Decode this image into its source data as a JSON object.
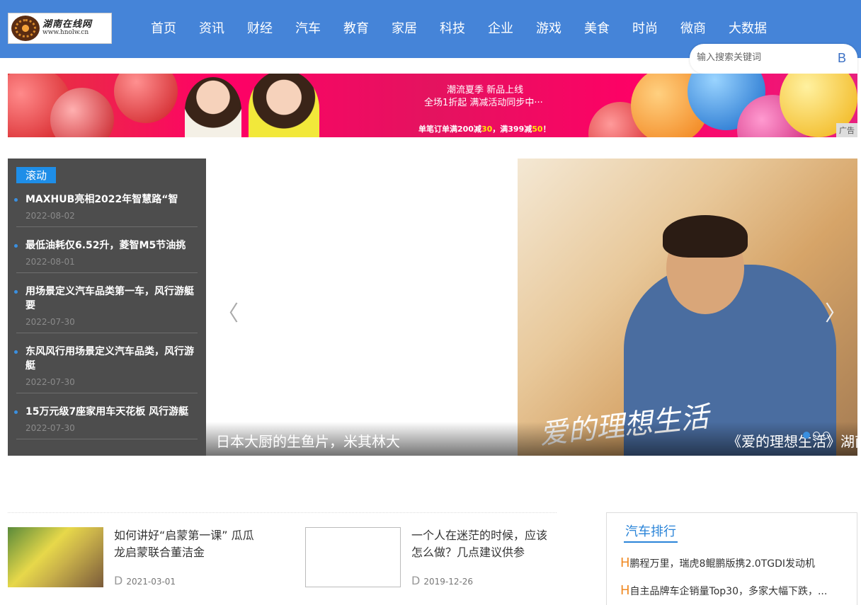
{
  "header": {
    "logo_cn": "湖南在线网",
    "logo_url": "www.hnolw.cn",
    "nav": [
      "首页",
      "资讯",
      "财经",
      "汽车",
      "教育",
      "家居",
      "科技",
      "企业",
      "游戏",
      "美食",
      "时尚",
      "微商",
      "大数据"
    ],
    "search_placeholder": "输入搜索关键词",
    "search_button": "B"
  },
  "ad": {
    "line1": "潮流夏季  新品上线",
    "line2": "全场1折起  满减活动同步中···",
    "line3_a": "单笔订单满200减",
    "line3_b": "30",
    "line3_c": "，满399减",
    "line3_d": "50",
    "line3_e": "！",
    "tag": "广告"
  },
  "scroll": {
    "tag": "滚动",
    "items": [
      {
        "title": "MAXHUB亮相2022年智慧路“智",
        "date": "2022-08-02"
      },
      {
        "title": "最低油耗仅6.52升，菱智M5节油挑",
        "date": "2022-08-01"
      },
      {
        "title": "用场景定义汽车品类第一车，风行游艇要",
        "date": "2022-07-30"
      },
      {
        "title": "东风风行用场景定义汽车品类，风行游艇",
        "date": "2022-07-30"
      },
      {
        "title": "15万元级7座家用车天花板 风行游艇",
        "date": "2022-07-30"
      }
    ]
  },
  "slider": {
    "caption_left": "日本大厨的生鱼片，米其林大",
    "caption_right": "《爱的理想生活》湖南",
    "photo_art": "爱的理想生活",
    "prev": "〈",
    "next": "〉"
  },
  "news": [
    {
      "title": "如何讲好“启蒙第一课” 瓜瓜龙启蒙联合董洁金",
      "date": "2021-03-01",
      "prefix": "D"
    },
    {
      "title": "一个人在迷茫的时候，应该怎么做？几点建议供参",
      "date": "2019-12-26",
      "prefix": "D"
    }
  ],
  "ranking": {
    "title": "汽车排行",
    "items": [
      {
        "prefix": "H",
        "text": "鹏程万里，瑞虎8鲲鹏版携2.0TGDI发动机"
      },
      {
        "prefix": "H",
        "text": "自主品牌车企销量Top30，多家大幅下跌，..."
      }
    ]
  },
  "colors": {
    "header_bg": "#4584d8",
    "accent": "#1e8ee8",
    "rank_prefix": "#f08a24"
  }
}
